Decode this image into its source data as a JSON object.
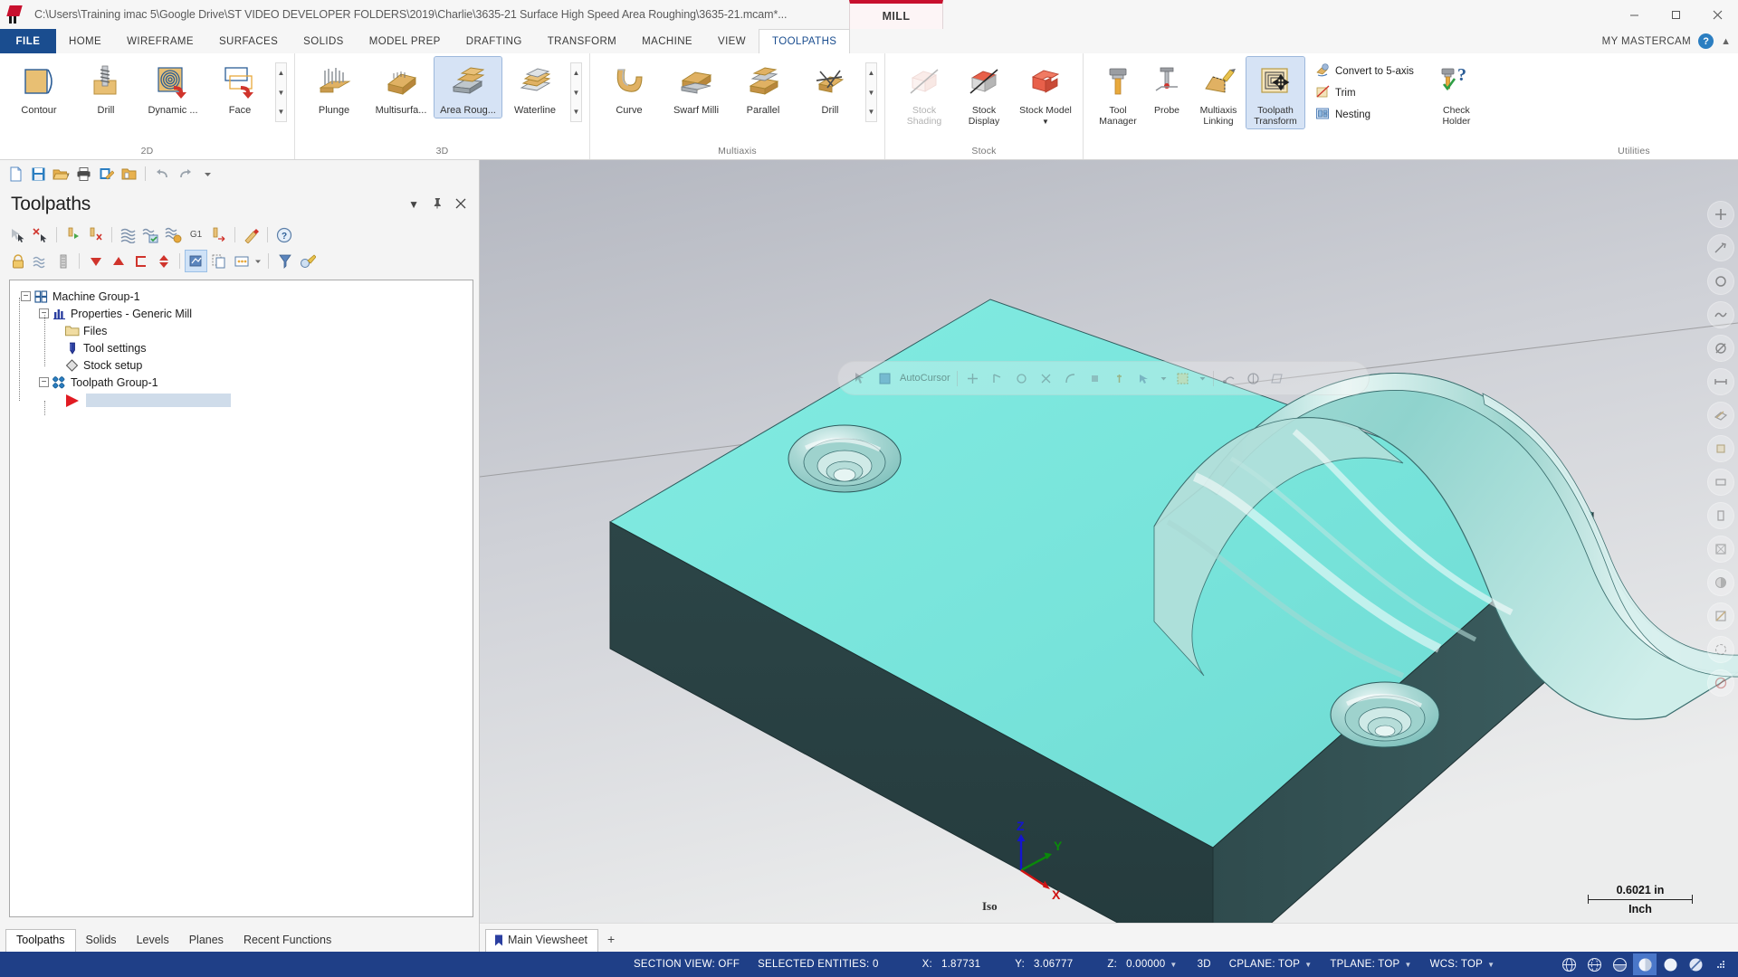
{
  "window": {
    "title": "C:\\Users\\Training imac 5\\Google Drive\\ST VIDEO DEVELOPER FOLDERS\\2019\\Charlie\\3635-21 Surface High Speed Area Roughing\\3635-21.mcam*...",
    "mill_tab": "MILL",
    "minimize": "minimize-icon",
    "maximize": "maximize-icon",
    "close": "close-icon"
  },
  "menubar": {
    "file": "FILE",
    "items": [
      {
        "label": "HOME",
        "active": false
      },
      {
        "label": "WIREFRAME",
        "active": false
      },
      {
        "label": "SURFACES",
        "active": false
      },
      {
        "label": "SOLIDS",
        "active": false
      },
      {
        "label": "MODEL PREP",
        "active": false
      },
      {
        "label": "DRAFTING",
        "active": false
      },
      {
        "label": "TRANSFORM",
        "active": false
      },
      {
        "label": "MACHINE",
        "active": false
      },
      {
        "label": "VIEW",
        "active": false
      },
      {
        "label": "TOOLPATHS",
        "active": true
      }
    ],
    "my_mastercam": "MY MASTERCAM",
    "help": "?",
    "collapse": "chevron-up-icon"
  },
  "ribbon": {
    "groups": [
      {
        "label": "2D",
        "buttons": [
          {
            "label": "Contour",
            "icon": "contour-icon",
            "state": "normal"
          },
          {
            "label": "Drill",
            "icon": "drill-icon",
            "state": "normal"
          },
          {
            "label": "Dynamic ...",
            "icon": "dynamic-mill-icon",
            "state": "normal"
          },
          {
            "label": "Face",
            "icon": "face-icon",
            "state": "normal"
          }
        ],
        "has_scroller": true
      },
      {
        "label": "3D",
        "buttons": [
          {
            "label": "Plunge",
            "icon": "plunge-icon",
            "state": "normal"
          },
          {
            "label": "Multisurfa...",
            "icon": "multisurface-icon",
            "state": "normal"
          },
          {
            "label": "Area Roug...",
            "icon": "area-roughing-icon",
            "state": "selected"
          },
          {
            "label": "Waterline",
            "icon": "waterline-icon",
            "state": "normal"
          }
        ],
        "has_scroller": true
      },
      {
        "label": "Multiaxis",
        "buttons": [
          {
            "label": "Curve",
            "icon": "curve-icon",
            "state": "normal"
          },
          {
            "label": "Swarf Milli",
            "icon": "swarf-milling-icon",
            "state": "normal"
          },
          {
            "label": "Parallel",
            "icon": "parallel-icon",
            "state": "normal"
          },
          {
            "label": "Drill",
            "icon": "multiaxis-drill-icon",
            "state": "normal"
          }
        ],
        "has_scroller": true
      },
      {
        "label": "Stock",
        "buttons": [
          {
            "label": "Stock Shading",
            "icon": "stock-shading-icon",
            "state": "disabled"
          },
          {
            "label": "Stock Display",
            "icon": "stock-display-icon",
            "state": "normal"
          },
          {
            "label": "Stock Model",
            "icon": "stock-model-icon",
            "state": "normal",
            "dropdown": true
          }
        ],
        "has_scroller": false
      },
      {
        "label": "Utilities",
        "buttons": [
          {
            "label": "Tool Manager",
            "icon": "tool-manager-icon",
            "state": "normal"
          },
          {
            "label": "Probe",
            "icon": "probe-icon",
            "state": "normal"
          },
          {
            "label": "Multiaxis Linking",
            "icon": "multiaxis-linking-icon",
            "state": "normal"
          },
          {
            "label": "Toolpath Transform",
            "icon": "toolpath-transform-icon",
            "state": "normal"
          }
        ],
        "small_buttons": [
          {
            "label": "Convert to 5-axis",
            "icon": "convert-5axis-icon"
          },
          {
            "label": "Trim",
            "icon": "trim-icon"
          },
          {
            "label": "Nesting",
            "icon": "nesting-icon"
          }
        ],
        "tall_buttons": [
          {
            "label": "Check Holder",
            "icon": "check-holder-icon"
          }
        ],
        "has_scroller": false
      }
    ]
  },
  "quick_access": {
    "icons": [
      "new-file-icon",
      "save-icon",
      "open-folder-icon",
      "print-icon",
      "edit-file-icon",
      "folder-properties-icon",
      "undo-icon",
      "redo-icon",
      "customize-qat-icon"
    ]
  },
  "toolpaths_panel": {
    "title": "Toolpaths",
    "header_buttons": [
      "chevron-down-icon",
      "pin-icon",
      "close-icon"
    ],
    "toolbar_row1": [
      "select-all-toolpaths-icon",
      "deselect-all-toolpaths-icon",
      "regenerate-selected-icon",
      "regenerate-invalid-icon",
      "backplot-icon",
      "verify-icon",
      "simulate-icon",
      "post-g1-icon",
      "high-speed-toolpath-icon",
      "edit-toolpath-icon",
      "help-icon"
    ],
    "toolbar_row2": [
      "lock-icon",
      "toggle-posting-icon",
      "toggle-toolpath-display-icon",
      "move-down-icon",
      "move-up-icon",
      "toolpath-group-icon",
      "move-updown-icon",
      "toolpath-display-icon",
      "copy-icon",
      "properties-icon",
      "dropdown-icon",
      "sort-icon",
      "tool-edit-icon"
    ],
    "tree": [
      {
        "label": "Machine Group-1",
        "level": 0,
        "icon": "machine-group-icon",
        "expander": "-"
      },
      {
        "label": "Properties - Generic Mill",
        "level": 1,
        "icon": "properties-icon",
        "expander": "-"
      },
      {
        "label": "Files",
        "level": 2,
        "icon": "files-folder-icon",
        "expander": ""
      },
      {
        "label": "Tool settings",
        "level": 2,
        "icon": "tool-settings-icon",
        "expander": ""
      },
      {
        "label": "Stock setup",
        "level": 2,
        "icon": "stock-setup-icon",
        "expander": ""
      },
      {
        "label": "Toolpath Group-1",
        "level": 1,
        "icon": "toolpath-group-icon",
        "expander": "-"
      },
      {
        "label": "",
        "level": 2,
        "icon": "insert-arrow-icon",
        "expander": "",
        "selected_blank": true
      }
    ]
  },
  "panel_tabs": [
    {
      "label": "Toolpaths",
      "active": true
    },
    {
      "label": "Solids",
      "active": false
    },
    {
      "label": "Levels",
      "active": false
    },
    {
      "label": "Planes",
      "active": false
    },
    {
      "label": "Recent Functions",
      "active": false
    }
  ],
  "viewport": {
    "toolbar_label": "AutoCursor",
    "toolbar_icons": [
      "autocursor-icon",
      "select-icon",
      "endpoint-icon",
      "midpoint-icon",
      "center-icon",
      "intersection-icon",
      "quadrant-icon",
      "point-icon",
      "along-icon",
      "nearest-icon",
      "dropdown-icon",
      "grid-icon",
      "dropdown-icon",
      "dynamic-icon",
      "relative-icon",
      "shading-icon"
    ],
    "right_toolbar_icons": [
      "fit-screen-icon",
      "zoom-window-icon",
      "unzoom-icon",
      "dynamic-rotate-icon",
      "pan-icon",
      "zoom-target-icon",
      "isometric-view-icon",
      "top-view-icon",
      "front-view-icon",
      "right-view-icon",
      "wireframe-icon",
      "shaded-icon",
      "section-icon",
      "translucency-icon",
      "no-display-icon"
    ],
    "gnomon": {
      "x": "X",
      "y": "Y",
      "z": "Z"
    },
    "view_name": "Iso",
    "scale_value": "0.6021 in",
    "scale_unit": "Inch",
    "sheet_tabs": [
      {
        "label": "Main Viewsheet",
        "active": true
      }
    ],
    "sheet_add": "+"
  },
  "statusbar": {
    "section_view": "SECTION VIEW: OFF",
    "selected_entities": "SELECTED ENTITIES: 0",
    "x_label": "X:",
    "x_value": "1.87731",
    "y_label": "Y:",
    "y_value": "3.06777",
    "z_label": "Z:",
    "z_value": "0.00000",
    "mode_3d": "3D",
    "cplane": "CPLANE: TOP",
    "tplane": "TPLANE: TOP",
    "wcs": "WCS: TOP",
    "icons": [
      "wireframe-display-icon",
      "hidden-lines-icon",
      "shaded-wireframe-icon",
      "shaded-icon",
      "material-shaded-icon",
      "translucent-icon",
      "resize-grip-icon"
    ]
  },
  "colors": {
    "accent_blue": "#1f3f87",
    "file_menu_blue": "#1a4d8f",
    "mill_red": "#c8102e",
    "model_cyan": "#7fe5dd",
    "model_dark": "#2b4446",
    "viewport_bg_top": "#b9bcc4",
    "viewport_bg_bottom": "#e8e9ec",
    "tree_selection": "#cfdcea"
  }
}
